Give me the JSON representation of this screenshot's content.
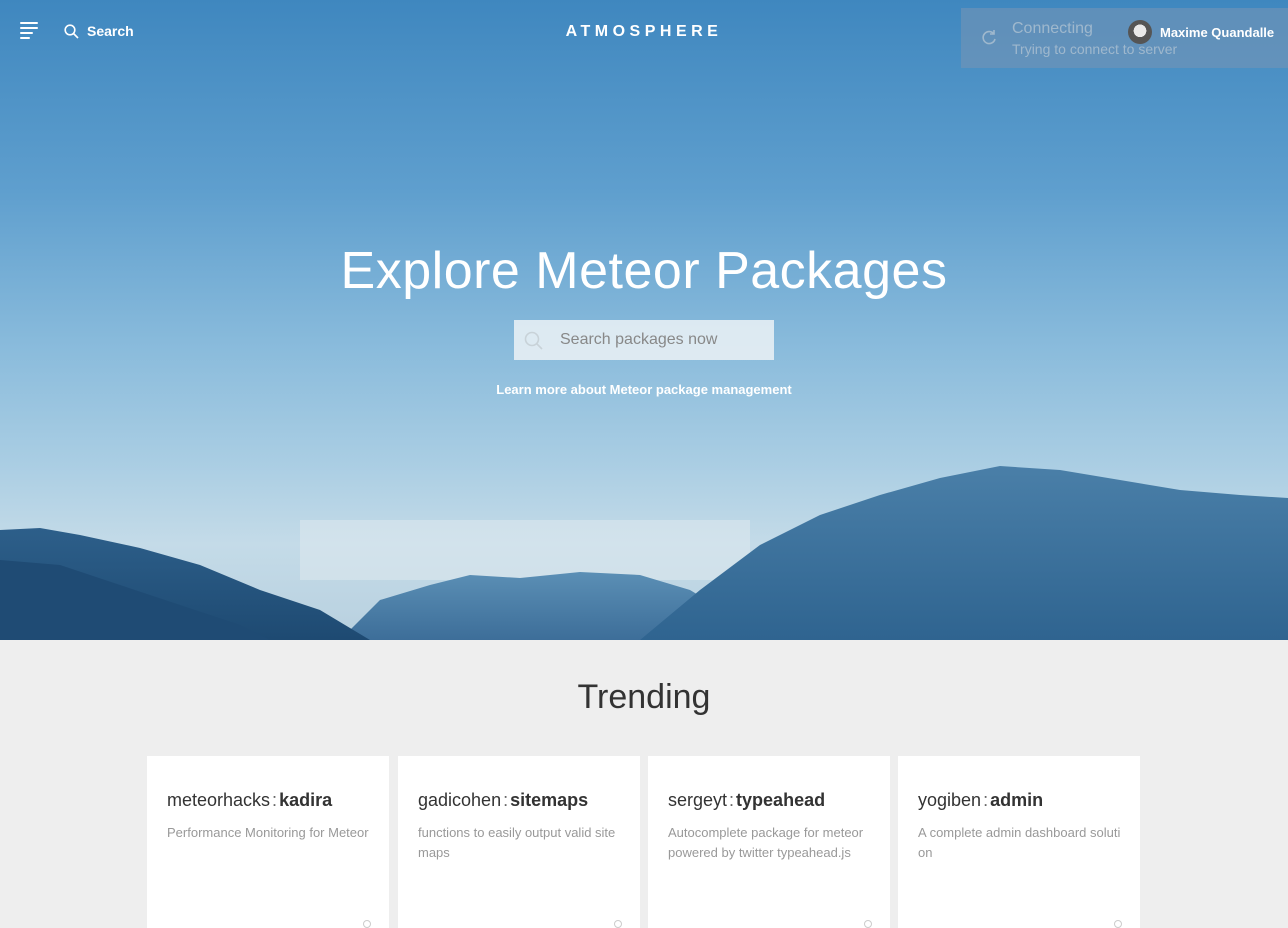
{
  "header": {
    "menu_icon": "hamburger-menu-icon",
    "search_label": "Search",
    "search_icon": "search-icon",
    "brand": "ATMOSPHERE"
  },
  "status": {
    "icon": "refresh-icon",
    "title": "Connecting",
    "subtitle": "Trying to connect to server"
  },
  "user": {
    "name": "Maxime Quandalle"
  },
  "hero": {
    "headline": "Explore Meteor Packages",
    "search_placeholder": "Search packages now",
    "learn_more": "Learn more about Meteor package management"
  },
  "trending": {
    "title": "Trending",
    "packages": [
      {
        "owner": "meteorhacks",
        "separator": ":",
        "name": "kadira",
        "description": "Performance Monitoring for Meteor"
      },
      {
        "owner": "gadicohen",
        "separator": ":",
        "name": "sitemaps",
        "description": "functions to easily output valid sitemaps"
      },
      {
        "owner": "sergeyt",
        "separator": ":",
        "name": "typeahead",
        "description": "Autocomplete package for meteor powered by twitter typeahead.js"
      },
      {
        "owner": "yogiben",
        "separator": ":",
        "name": "admin",
        "description": "A complete admin dashboard solution"
      }
    ]
  },
  "colors": {
    "sky_top": "#3f87bf",
    "sky_bottom": "#c4dbe8",
    "mountain_dark": "#2b5a84",
    "page_bg": "#eeeeee"
  }
}
